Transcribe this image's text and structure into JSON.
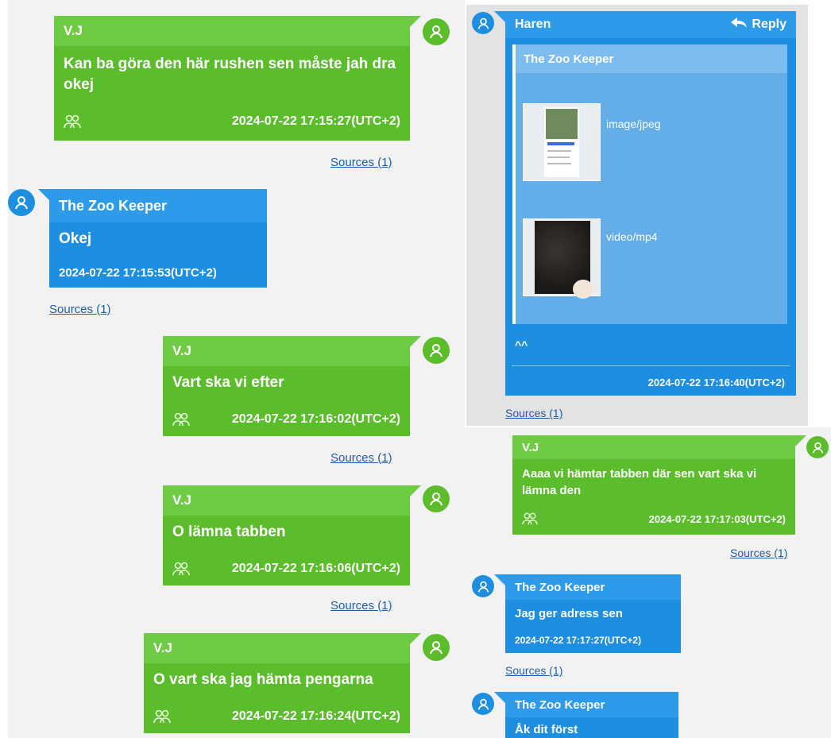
{
  "colors": {
    "green_bubble": "#5bbd2b",
    "blue_bubble": "#1e8fe0",
    "link": "#1b5fa8",
    "panel_bg": "#f2f2f2",
    "highlight_bg": "#e3e3e3"
  },
  "left_column": [
    {
      "sender": "V.J",
      "text": "Kan ba göra den här rushen sen måste jah dra okej",
      "timestamp": "2024-07-22 17:15:27(UTC+2)",
      "sources": "Sources (1)",
      "side": "outgoing",
      "icon": "group-icon"
    },
    {
      "sender": "The Zoo Keeper",
      "text": "Okej",
      "timestamp": "2024-07-22 17:15:53(UTC+2)",
      "sources": "Sources (1)",
      "side": "incoming"
    },
    {
      "sender": "V.J",
      "text": "Vart ska vi efter",
      "timestamp": "2024-07-22 17:16:02(UTC+2)",
      "sources": "Sources (1)",
      "side": "outgoing",
      "icon": "group-icon"
    },
    {
      "sender": "V.J",
      "text": "O lämna tabben",
      "timestamp": "2024-07-22 17:16:06(UTC+2)",
      "sources": "Sources (1)",
      "side": "outgoing",
      "icon": "group-icon"
    },
    {
      "sender": "V.J",
      "text": "O vart ska jag hämta pengarna",
      "timestamp": "2024-07-22 17:16:24(UTC+2)",
      "side": "outgoing",
      "icon": "group-icon"
    }
  ],
  "reply_message": {
    "sender": "Haren",
    "reply_label": "Reply",
    "quoted": {
      "sender": "The Zoo Keeper",
      "attachments": [
        {
          "type_label": "image/jpeg",
          "icon": "image-thumbnail"
        },
        {
          "type_label": "video/mp4",
          "icon": "video-thumbnail"
        }
      ]
    },
    "text": "^^",
    "timestamp": "2024-07-22 17:16:40(UTC+2)",
    "sources": "Sources (1)"
  },
  "right_column": [
    {
      "sender": "V.J",
      "text": "Aaaa vi hämtar tabben där sen vart ska vi lämna den",
      "timestamp": "2024-07-22 17:17:03(UTC+2)",
      "sources": "Sources (1)",
      "side": "outgoing",
      "icon": "group-icon"
    },
    {
      "sender": "The Zoo Keeper",
      "text": "Jag ger adress sen",
      "timestamp": "2024-07-22 17:17:27(UTC+2)",
      "sources": "Sources (1)",
      "side": "incoming"
    },
    {
      "sender": "The Zoo Keeper",
      "text": "Åk dit först",
      "side": "incoming"
    }
  ]
}
